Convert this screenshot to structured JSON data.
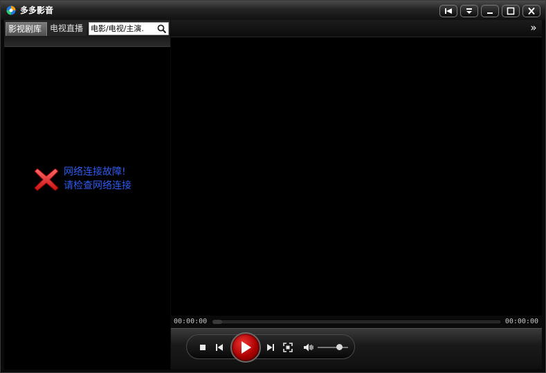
{
  "app": {
    "title": "多多影音"
  },
  "window_controls": [
    {
      "name": "pin-button",
      "icon": "pin-icon"
    },
    {
      "name": "menu-button",
      "icon": "dropdown-icon"
    },
    {
      "name": "minimize-button",
      "icon": "minimize-icon"
    },
    {
      "name": "maximize-button",
      "icon": "maximize-icon"
    },
    {
      "name": "close-button",
      "icon": "close-icon"
    }
  ],
  "sidebar": {
    "tabs": [
      {
        "label": "影视剧库",
        "active": true
      },
      {
        "label": "电视直播",
        "active": false
      }
    ],
    "search": {
      "placeholder": "电影/电视/主演."
    },
    "error": {
      "line1": "网络连接故障!",
      "line2": "请检查网络连接"
    }
  },
  "player": {
    "time_current": "00:00:00",
    "time_total": "00:00:00",
    "progress": 0,
    "volume": 0.7,
    "colors": {
      "play_button": "#cc0000",
      "error_text": "#2f5bf0"
    }
  }
}
